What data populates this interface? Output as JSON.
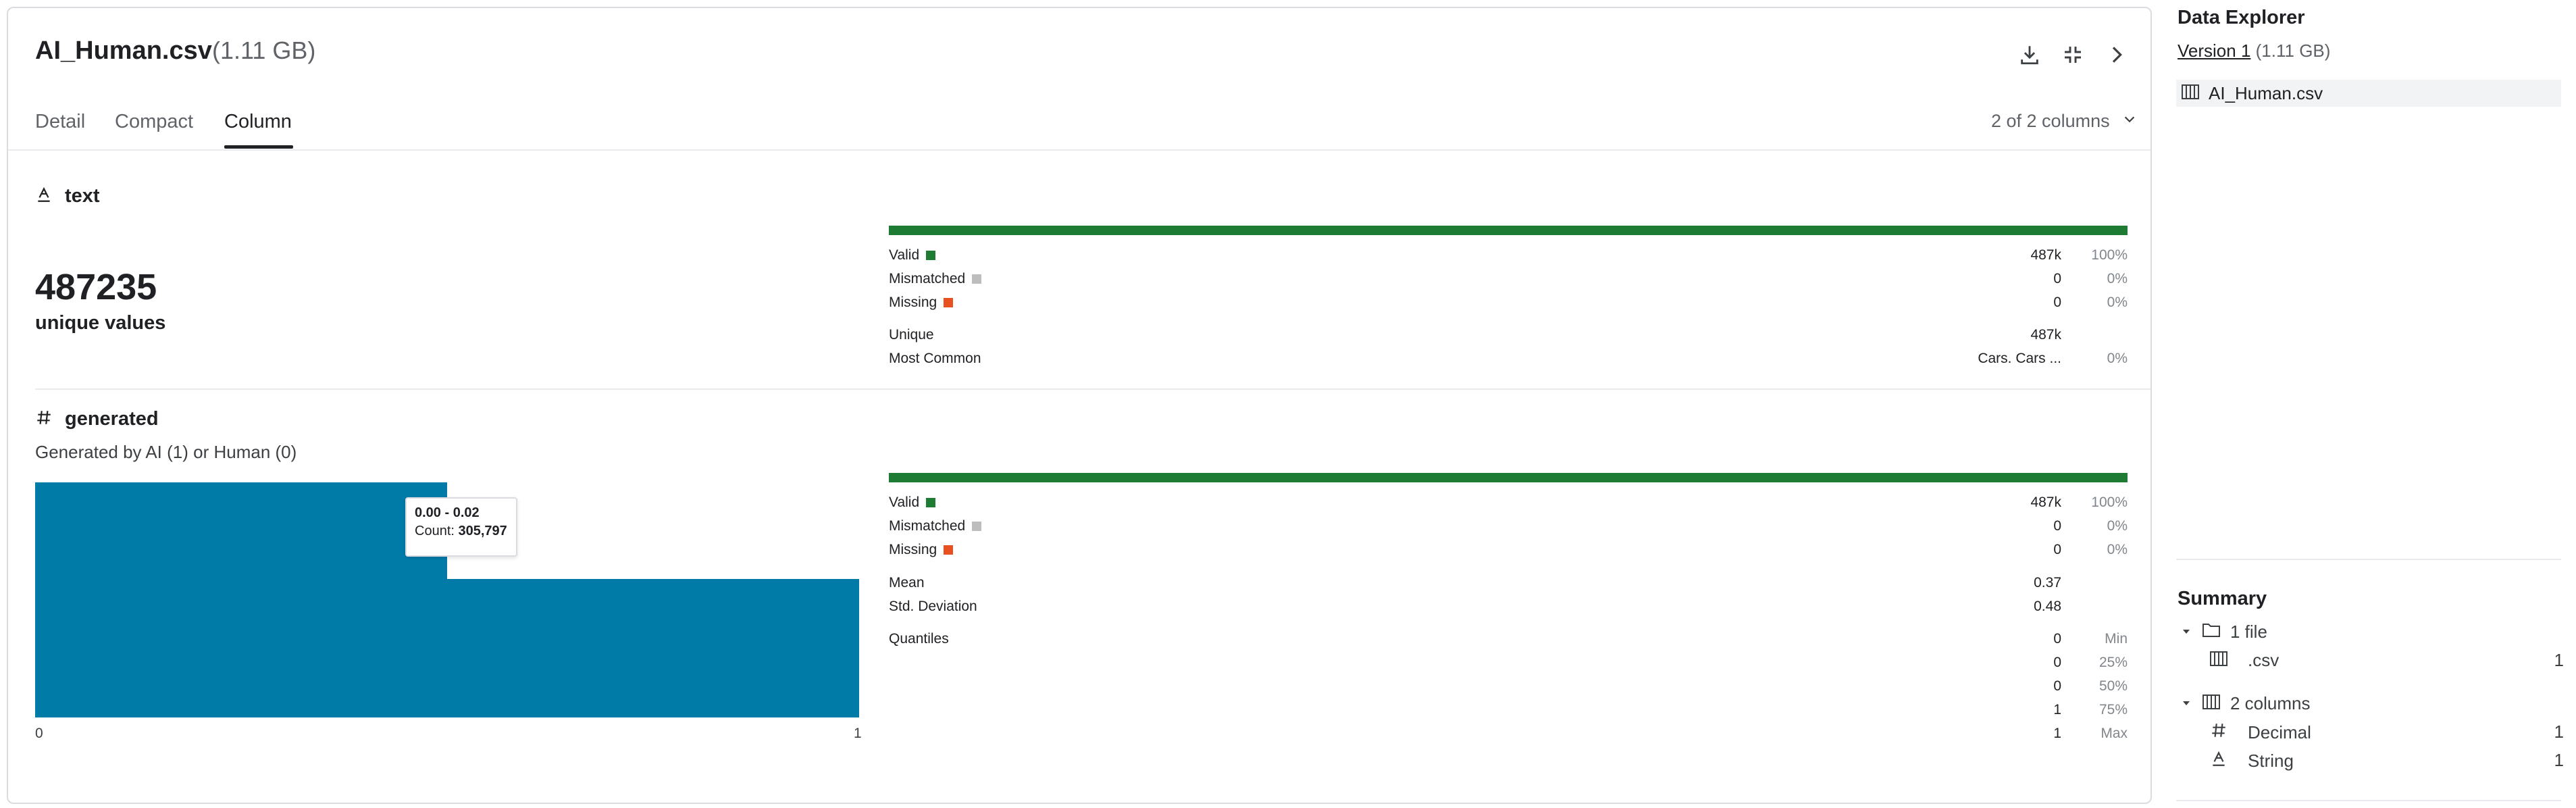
{
  "header": {
    "file_name": "AI_Human.csv",
    "file_size": "(1.11 GB)",
    "icons": [
      "download-icon",
      "collapse-icon",
      "chevron-right-icon"
    ]
  },
  "tabs": [
    {
      "label": "Detail",
      "active": false
    },
    {
      "label": "Compact",
      "active": false
    },
    {
      "label": "Column",
      "active": true
    }
  ],
  "column_count": "2 of 2 columns",
  "columns": [
    {
      "name": "text",
      "type_icon": "string-icon",
      "big_value": "487235",
      "big_label": "unique values",
      "valid_fraction": 1.0,
      "stats": {
        "valid": {
          "label": "Valid",
          "value": "487k",
          "pct": "100%",
          "color": "#1e7b34"
        },
        "mismatched": {
          "label": "Mismatched",
          "value": "0",
          "pct": "0%",
          "color": "#bdbdbd"
        },
        "missing": {
          "label": "Missing",
          "value": "0",
          "pct": "0%",
          "color": "#e8501f"
        },
        "unique": {
          "label": "Unique",
          "value": "487k"
        },
        "most_common": {
          "label": "Most Common",
          "value": "Cars. Cars ...",
          "pct": "0%"
        }
      }
    },
    {
      "name": "generated",
      "type_icon": "hash-icon",
      "description": "Generated by AI (1) or Human (0)",
      "valid_fraction": 1.0,
      "histogram": {
        "bars": [
          305797,
          180000
        ],
        "color": "#007ba8",
        "x_min_label": "0",
        "x_max_label": "1",
        "tooltip": {
          "range": "0.00 - 0.02",
          "count_label": "Count:",
          "count": "305,797"
        }
      },
      "stats": {
        "valid": {
          "label": "Valid",
          "value": "487k",
          "pct": "100%"
        },
        "mismatched": {
          "label": "Mismatched",
          "value": "0",
          "pct": "0%"
        },
        "missing": {
          "label": "Missing",
          "value": "0",
          "pct": "0%"
        },
        "mean": {
          "label": "Mean",
          "value": "0.37"
        },
        "std": {
          "label": "Std. Deviation",
          "value": "0.48"
        },
        "quantiles_label": "Quantiles",
        "quantiles": [
          {
            "value": "0",
            "label": "Min"
          },
          {
            "value": "0",
            "label": "25%"
          },
          {
            "value": "0",
            "label": "50%"
          },
          {
            "value": "1",
            "label": "75%"
          },
          {
            "value": "1",
            "label": "Max"
          }
        ]
      }
    }
  ],
  "explorer": {
    "title": "Data Explorer",
    "version": "Version 1",
    "version_size": "(1.11 GB)",
    "file": "AI_Human.csv"
  },
  "summary": {
    "title": "Summary",
    "files_label": "1 file",
    "file_types": [
      {
        "label": ".csv",
        "count": "1"
      }
    ],
    "columns_label": "2 columns",
    "column_types": [
      {
        "label": "Decimal",
        "count": "1",
        "icon": "hash-icon"
      },
      {
        "label": "String",
        "count": "1",
        "icon": "string-icon"
      }
    ]
  }
}
